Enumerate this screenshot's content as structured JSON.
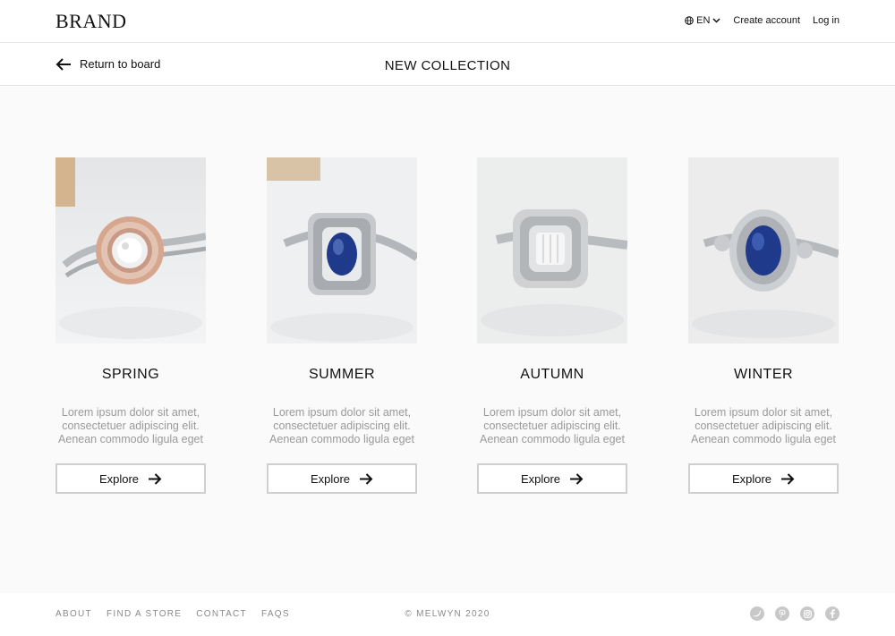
{
  "header": {
    "brand": "BRAND",
    "language": "EN",
    "create_account": "Create account",
    "login": "Log in"
  },
  "subheader": {
    "back_label": "Return to board",
    "title": "NEW COLLECTION"
  },
  "collections": [
    {
      "title": "SPRING",
      "desc_lines": [
        "Lorem ipsum dolor sit amet,",
        "consectetuer adipiscing elit.",
        "Aenean commodo ligula eget"
      ],
      "button": "Explore",
      "image": "rose-gold-diamond-ring"
    },
    {
      "title": "SUMMER",
      "desc_lines": [
        "Lorem ipsum dolor sit amet,",
        "consectetuer adipiscing elit.",
        "Aenean commodo ligula eget"
      ],
      "button": "Explore",
      "image": "sapphire-halo-ring"
    },
    {
      "title": "AUTUMN",
      "desc_lines": [
        "Lorem ipsum dolor sit amet,",
        "consectetuer adipiscing elit.",
        "Aenean commodo ligula eget"
      ],
      "button": "Explore",
      "image": "diamond-cushion-ring"
    },
    {
      "title": "WINTER",
      "desc_lines": [
        "Lorem ipsum dolor sit amet,",
        "consectetuer adipiscing elit.",
        "Aenean commodo ligula eget"
      ],
      "button": "Explore",
      "image": "blue-sapphire-ring"
    }
  ],
  "footer": {
    "links": [
      "ABOUT",
      "FIND A STORE",
      "CONTACT",
      "FAQS"
    ],
    "copyright": "© MELWYN 2020",
    "socials": [
      "twitter-icon",
      "pinterest-icon",
      "instagram-icon",
      "facebook-icon"
    ]
  },
  "colors": {
    "text": "#111111",
    "muted": "#9a9a9a",
    "background": "#fafafa",
    "border": "#cfcfcf",
    "sapphire": "#1f3a8a"
  }
}
